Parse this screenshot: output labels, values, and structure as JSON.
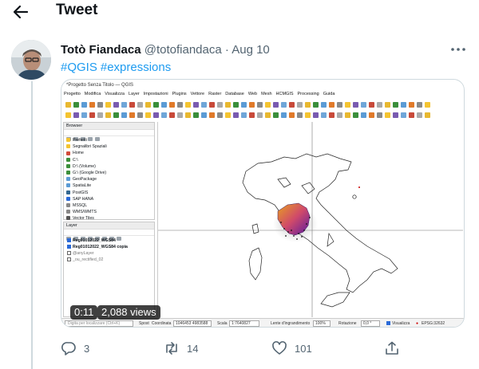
{
  "header": {
    "title": "Tweet"
  },
  "tweet": {
    "author_name": "Totò Fiandaca",
    "author_handle": "@totofiandaca",
    "separator": "·",
    "date": "Aug 10",
    "hashtags": [
      "#QGIS",
      "#expressions"
    ],
    "video": {
      "time": "0:11",
      "views": "2,088 views"
    },
    "actions": {
      "replies": "3",
      "retweets": "14",
      "likes": "101"
    }
  },
  "qgis": {
    "window_title": "*Progetto Senza Titolo — QGIS",
    "menu": [
      "Progetto",
      "Modifica",
      "Visualizza",
      "Layer",
      "Impostazioni",
      "Plugins",
      "Vettore",
      "Raster",
      "Database",
      "Web",
      "Mesh",
      "HCMGIS",
      "Processing",
      "Guida"
    ],
    "browser_title": "Browser",
    "browser_items": [
      {
        "label": "Preferiti",
        "color": "#f4c431"
      },
      {
        "label": "Segnalibri Spaziali",
        "color": "#f4c431"
      },
      {
        "label": "Home",
        "color": "#d24a3a"
      },
      {
        "label": "C:\\",
        "color": "#3b8f3b"
      },
      {
        "label": "D:\\ (Volume)",
        "color": "#3b8f3b"
      },
      {
        "label": "G:\\ (Google Drive)",
        "color": "#3b8f3b"
      },
      {
        "label": "GeoPackage",
        "color": "#5b9bd5"
      },
      {
        "label": "SpatiaLite",
        "color": "#5b9bd5"
      },
      {
        "label": "PostGIS",
        "color": "#336791"
      },
      {
        "label": "SAP HANA",
        "color": "#2a6ad8"
      },
      {
        "label": "MSSQL",
        "color": "#888888"
      },
      {
        "label": "WMS/WMTS",
        "color": "#888888"
      },
      {
        "label": "Vector Tiles",
        "color": "#555555"
      }
    ],
    "layers_title": "Layer",
    "layers": [
      {
        "label": "Reg01012022_WGS84",
        "checked": true,
        "bold": true
      },
      {
        "label": "Reg01012022_WGS84 copia",
        "checked": true,
        "bold": true
      },
      {
        "label": "@anyLayer",
        "checked": false,
        "bold": false
      },
      {
        "label": "_ou_rectified_02",
        "checked": false,
        "bold": false
      }
    ],
    "status": {
      "search_placeholder": "Digita per localizzare (Ctrl+K)",
      "spost": "Spost",
      "coord_label": "Coordinata",
      "coord": "1046453 4983588",
      "scale_label": "Scala",
      "scale": "1:7640827",
      "lens_label": "Lente d'ingrandimento",
      "lens": "100%",
      "rotation_label": "Rotazione",
      "rotation": "0,0 °",
      "render_label": "Visualizza",
      "crs": "EPSG:32632"
    }
  },
  "colors": {
    "accent": "#1d9bf0",
    "text": "#0f1419",
    "muted": "#536471"
  }
}
